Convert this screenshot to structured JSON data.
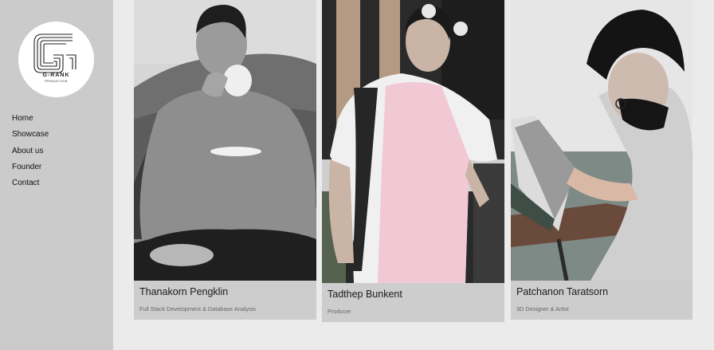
{
  "brand": {
    "name": "G-RANK",
    "tagline": "PRODUCTION"
  },
  "nav": {
    "items": [
      {
        "label": "Home"
      },
      {
        "label": "Showcase"
      },
      {
        "label": "About us"
      },
      {
        "label": "Founder"
      },
      {
        "label": "Contact"
      }
    ]
  },
  "team": [
    {
      "name": "Thanakorn Pengklin",
      "role": "Full Stack Development & Database Analysis"
    },
    {
      "name": "Tadthep Bunkent",
      "role": "Producer"
    },
    {
      "name": "Patchanon Taratsorn",
      "role": "3D Designer & Artist"
    }
  ],
  "colors": {
    "page_background": "#ebebeb",
    "sidebar_background": "#cbcbcb",
    "card_background": "#cdcdcd"
  }
}
